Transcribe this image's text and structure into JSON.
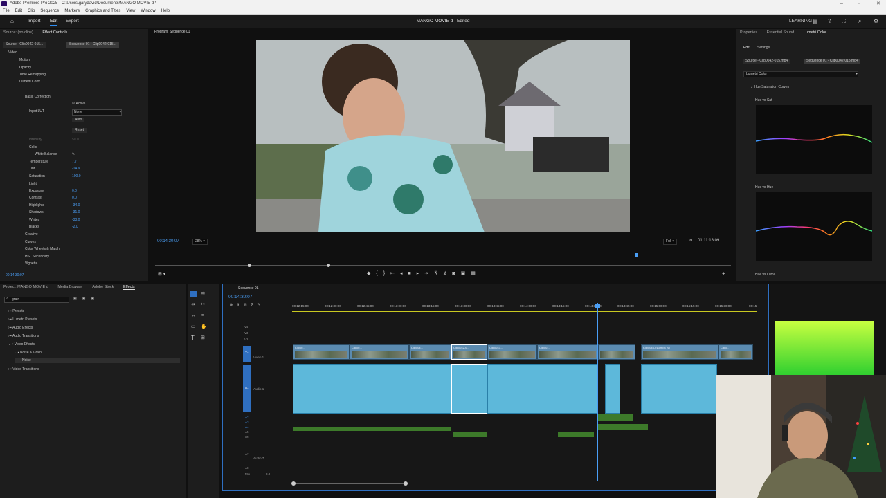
{
  "window": {
    "title": "Adobe Premiere Pro 2025 - C:\\Users\\garydavid\\Documents\\MANGO MOVIE d *"
  },
  "menu": [
    "File",
    "Edit",
    "Clip",
    "Sequence",
    "Markers",
    "Graphics and Titles",
    "View",
    "Window",
    "Help"
  ],
  "workspace": {
    "tabs": [
      "Import",
      "Edit",
      "Export"
    ],
    "project_title": "MANGO MOVIE d - Edited",
    "learning": "LEARNING"
  },
  "effect_controls": {
    "tabs": [
      "Source: (no clips)",
      "Effect Controls"
    ],
    "source": "Source - Clip0042-015...",
    "sequence": "Sequence 01 - Clip0042-015...",
    "video_label": "Video",
    "items": [
      "Motion",
      "Opacity",
      "Time Remapping",
      "Lumetri Color"
    ],
    "basic_correction": "Basic Correction",
    "active": "Active",
    "input_lut": "Input LUT",
    "lut_value": "None",
    "auto": "Auto",
    "reset": "Reset",
    "intensity": "Intensity",
    "intensity_value": "50.0",
    "color": "Color",
    "white_balance": "White Balance",
    "params": [
      {
        "label": "Temperature",
        "value": "7.7"
      },
      {
        "label": "Tint",
        "value": "-14.9"
      },
      {
        "label": "Saturation",
        "value": "100.0"
      }
    ],
    "light": "Light",
    "light_params": [
      {
        "label": "Exposure",
        "value": "0.0"
      },
      {
        "label": "Contrast",
        "value": "0.0"
      },
      {
        "label": "Highlights",
        "value": "-34.0"
      },
      {
        "label": "Shadows",
        "value": "-31.0"
      },
      {
        "label": "Whites",
        "value": "-33.0"
      },
      {
        "label": "Blacks",
        "value": "-2.0"
      }
    ],
    "sections": [
      "Creative",
      "Curves",
      "Color Wheels & Match",
      "HSL Secondary",
      "Vignette"
    ],
    "timecode": "00:14:30:07"
  },
  "program": {
    "tab": "Program: Sequence 01",
    "timecode": "00:14:30:07",
    "zoom": "28%",
    "quality": "Full",
    "duration": "01:11:18:09"
  },
  "lumetri": {
    "tabs": [
      "Properties",
      "Essential Sound",
      "Lumetri Color"
    ],
    "subtabs": [
      "Edit",
      "Settings"
    ],
    "source": "Source - Clip0042-015.mp4",
    "sequence": "Sequence 01 - Clip0042-015.mp4",
    "dropdown": "Lumetri Color",
    "section": "Hue Saturation Curves",
    "curves": [
      "Hue vs Sat",
      "Hue vs Hue",
      "Hue vs Luma"
    ]
  },
  "project": {
    "tabs": [
      "Project: MANGO MOVIE d",
      "Media Browser",
      "Adobe Stock",
      "Effects"
    ],
    "search": "grain",
    "tree": [
      "Presets",
      "Lumetri Presets",
      "Audio Effects",
      "Audio Transitions",
      "Video Effects",
      "Noise & Grain",
      "Noise",
      "Video Transitions"
    ]
  },
  "timeline": {
    "tab": "Sequence 01",
    "timecode": "00:14:30:07",
    "ruler": [
      "00:12:15:00",
      "00:12:30:00",
      "00:12:45:00",
      "00:13:00:00",
      "00:13:15:00",
      "00:13:30:00",
      "00:13:45:00",
      "00:14:00:00",
      "00:14:15:00",
      "00:14:30:00",
      "00:14:45:00",
      "00:15:00:00",
      "00:15:15:00",
      "00:15:30:00",
      "00:15"
    ],
    "tracks": [
      "V4",
      "V3",
      "V2",
      "V1",
      "Video 1",
      "A1",
      "Audio 1",
      "A2",
      "A3",
      "A4",
      "A5",
      "A6",
      "A7",
      "Audio 7",
      "A8",
      "Mix"
    ],
    "mix_value": "0.0",
    "clips": [
      "Clip00...",
      "Clip00...",
      "Clip004...",
      "Clip0042-0...",
      "Clip0043...",
      "Clip00...",
      "Clip0045-013.mp4 [V]",
      "Clip0..."
    ]
  }
}
